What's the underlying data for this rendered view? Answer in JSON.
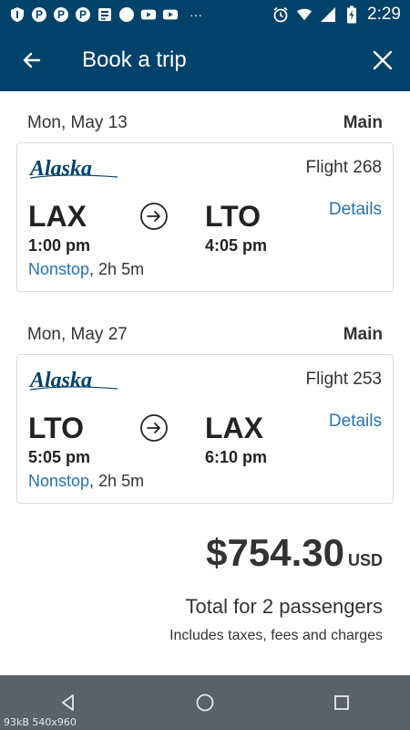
{
  "status_bar": {
    "time": "2:29",
    "icons": [
      "shield-icon",
      "pinterest-icon",
      "pinterest-icon",
      "pinterest-icon",
      "news-icon",
      "circle-icon",
      "youtube-icon",
      "youtube-icon",
      "more-icon",
      "alarm-icon",
      "wifi-icon",
      "signal-icon",
      "battery-icon"
    ],
    "more_glyph": "···"
  },
  "app_bar": {
    "title": "Book a trip",
    "background": "#01426a"
  },
  "legs": [
    {
      "date": "Mon, May 13",
      "cabin": "Main",
      "airline": "Alaska",
      "flight": "Flight 268",
      "from_code": "LAX",
      "to_code": "LTO",
      "depart_time": "1:00 pm",
      "arrive_time": "4:05 pm",
      "nonstop": "Nonstop",
      "duration": ", 2h 5m",
      "details_label": "Details"
    },
    {
      "date": "Mon, May 27",
      "cabin": "Main",
      "airline": "Alaska",
      "flight": "Flight 253",
      "from_code": "LTO",
      "to_code": "LAX",
      "depart_time": "5:05 pm",
      "arrive_time": "6:10 pm",
      "nonstop": "Nonstop",
      "duration": ", 2h 5m",
      "details_label": "Details"
    }
  ],
  "summary": {
    "price": "$754.30",
    "currency": "USD",
    "total": "Total for 2 passengers",
    "taxes": "Includes taxes, fees and charges"
  },
  "image_info": "93kB  540x960",
  "colors": {
    "brand": "#01426a",
    "link": "#2774ae"
  }
}
